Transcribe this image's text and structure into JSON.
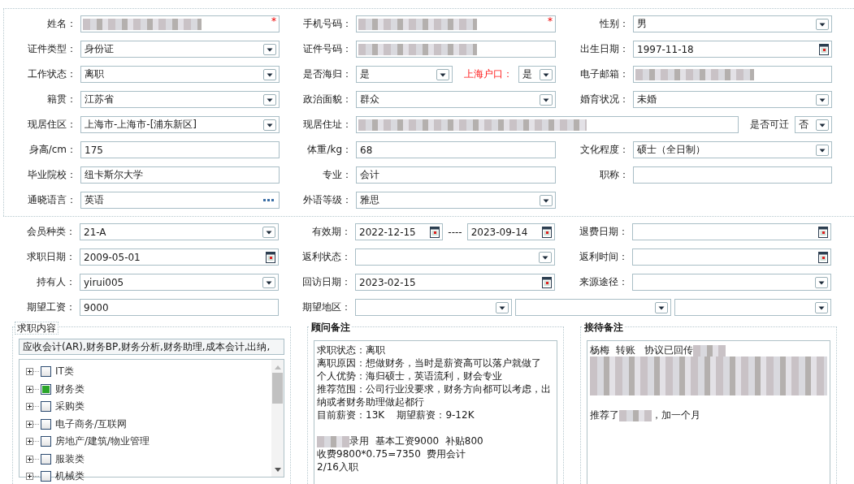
{
  "sections": [
    {
      "rows": [
        [
          {
            "label": "姓名：",
            "controls": [
              {
                "kind": "text",
                "redacted": true,
                "required_mark": "*"
              }
            ]
          },
          {
            "label": "手机号码：",
            "controls": [
              {
                "kind": "text",
                "redacted": true,
                "required_mark": "*"
              }
            ]
          },
          {
            "label": "性别：",
            "controls": [
              {
                "kind": "select",
                "value": "男"
              }
            ]
          }
        ],
        [
          {
            "label": "证件类型：",
            "controls": [
              {
                "kind": "select",
                "value": "身份证"
              }
            ]
          },
          {
            "label": "证件号码：",
            "controls": [
              {
                "kind": "text",
                "redacted": true
              }
            ]
          },
          {
            "label": "出生日期：",
            "controls": [
              {
                "kind": "date",
                "value": "1997-11-18"
              }
            ]
          }
        ],
        [
          {
            "label": "工作状态：",
            "controls": [
              {
                "kind": "select",
                "value": "离职"
              }
            ]
          },
          {
            "label": "是否海归：",
            "controls": [
              {
                "kind": "select",
                "value": "是"
              },
              {
                "kind": "label",
                "text": "上海户口：",
                "highlight": true
              },
              {
                "kind": "select",
                "value": "是"
              }
            ]
          },
          {
            "label": "电子邮箱：",
            "controls": [
              {
                "kind": "text",
                "redacted": true
              }
            ]
          }
        ],
        [
          {
            "label": "籍贯：",
            "controls": [
              {
                "kind": "select",
                "value": "江苏省"
              }
            ]
          },
          {
            "label": "政治面貌：",
            "controls": [
              {
                "kind": "select",
                "value": "群众"
              }
            ]
          },
          {
            "label": "婚育状况：",
            "controls": [
              {
                "kind": "select",
                "value": "未婚"
              }
            ]
          }
        ],
        [
          {
            "label": "现居住区：",
            "controls": [
              {
                "kind": "select",
                "value": "上海市-上海市-[浦东新区]"
              }
            ]
          },
          {
            "label": "现居住址：",
            "controls": [
              {
                "kind": "text",
                "redacted": true
              },
              {
                "kind": "label",
                "text": "是否可迁",
                "highlight": false
              },
              {
                "kind": "select",
                "value": "否"
              }
            ]
          }
        ],
        [
          {
            "label": "身高/cm：",
            "controls": [
              {
                "kind": "text",
                "value": "175"
              }
            ]
          },
          {
            "label": "体重/kg：",
            "controls": [
              {
                "kind": "text",
                "value": "68"
              }
            ]
          },
          {
            "label": "文化程度：",
            "controls": [
              {
                "kind": "select",
                "value": "硕士（全日制）"
              }
            ]
          }
        ],
        [
          {
            "label": "毕业院校：",
            "controls": [
              {
                "kind": "text",
                "value": "纽卡斯尔大学"
              }
            ]
          },
          {
            "label": "专业：",
            "controls": [
              {
                "kind": "text",
                "value": "会计"
              }
            ]
          },
          {
            "label": "职称：",
            "controls": [
              {
                "kind": "text"
              }
            ]
          }
        ],
        [
          {
            "label": "通晓语言：",
            "controls": [
              {
                "kind": "lookup",
                "value": "英语"
              }
            ]
          },
          {
            "label": "外语等级：",
            "controls": [
              {
                "kind": "select",
                "value": "雅思"
              }
            ]
          }
        ]
      ]
    },
    {
      "rows": [
        [
          {
            "label": "会员种类：",
            "controls": [
              {
                "kind": "select",
                "value": "21-A"
              }
            ]
          },
          {
            "label": "有效期：",
            "controls": [
              {
                "kind": "date",
                "value": "2022-12-15"
              },
              {
                "kind": "separator",
                "text": "----"
              },
              {
                "kind": "date",
                "value": "2023-09-14"
              }
            ]
          },
          {
            "label": "退费日期：",
            "controls": [
              {
                "kind": "date"
              }
            ]
          }
        ],
        [
          {
            "label": "求职日期：",
            "controls": [
              {
                "kind": "date",
                "value": "2009-05-01"
              }
            ]
          },
          {
            "label": "返利状态：",
            "controls": [
              {
                "kind": "select"
              }
            ]
          },
          {
            "label": "返利时间：",
            "controls": [
              {
                "kind": "date"
              }
            ]
          }
        ],
        [
          {
            "label": "持有人：",
            "controls": [
              {
                "kind": "select",
                "value": "yirui005"
              }
            ]
          },
          {
            "label": "回访日期：",
            "controls": [
              {
                "kind": "date",
                "value": "2023-02-15"
              }
            ]
          },
          {
            "label": "来源途径：",
            "controls": [
              {
                "kind": "select"
              }
            ]
          }
        ],
        [
          {
            "label": "期望工资：",
            "controls": [
              {
                "kind": "text",
                "value": "9000"
              }
            ]
          },
          {
            "label": "期望地区：",
            "controls": [
              {
                "kind": "select"
              },
              {
                "kind": "select"
              },
              {
                "kind": "select"
              }
            ]
          }
        ]
      ]
    }
  ],
  "job_content": {
    "title": "求职内容",
    "value": "应收会计(AR),财务BP,财务分析,财务助理,成本会计,出纳,",
    "categories": [
      {
        "label": "IT类",
        "checked": false
      },
      {
        "label": "财务类",
        "checked": true
      },
      {
        "label": "采购类",
        "checked": false
      },
      {
        "label": "电子商务/互联网",
        "checked": false
      },
      {
        "label": "房地产/建筑/物业管理",
        "checked": false
      },
      {
        "label": "服装类",
        "checked": false
      },
      {
        "label": "机械类",
        "checked": false
      }
    ]
  },
  "notes": [
    {
      "title": "顾问备注",
      "lines": [
        {
          "parts": [
            {
              "kind": "text",
              "text": "求职状态：离职"
            }
          ]
        },
        {
          "parts": [
            {
              "kind": "text",
              "text": "离职原因：想做财务，当时是薪资高可以落户就做了"
            }
          ]
        },
        {
          "parts": [
            {
              "kind": "text",
              "text": "个人优势：海归硕士，英语流利，财会专业"
            }
          ]
        },
        {
          "parts": [
            {
              "kind": "text",
              "text": "推荐范围：公司行业没要求，财务方向都可以考虑，出纳或者财务助理做起都行"
            }
          ]
        },
        {
          "parts": [
            {
              "kind": "text",
              "text": "目前薪资：13K    期望薪资：9-12K"
            }
          ]
        },
        {
          "gap_before": true,
          "parts": [
            {
              "kind": "redacted"
            },
            {
              "kind": "text",
              "text": "录用  基本工资9000  补贴800"
            }
          ]
        },
        {
          "parts": [
            {
              "kind": "text",
              "text": "收费9800*0.75=7350  费用会计"
            }
          ]
        },
        {
          "parts": [
            {
              "kind": "text",
              "text": "2/16入职"
            }
          ]
        }
      ]
    },
    {
      "title": "接待备注",
      "lines": [
        {
          "parts": [
            {
              "kind": "text",
              "text": "杨梅  转账   协议已回传"
            },
            {
              "kind": "redacted"
            }
          ]
        },
        {
          "parts": [
            {
              "kind": "redacted_block"
            }
          ]
        },
        {
          "gap_before": true,
          "parts": [
            {
              "kind": "text",
              "text": "推荐了"
            },
            {
              "kind": "redacted"
            },
            {
              "kind": "text",
              "text": "，加一个月"
            }
          ]
        }
      ]
    }
  ]
}
